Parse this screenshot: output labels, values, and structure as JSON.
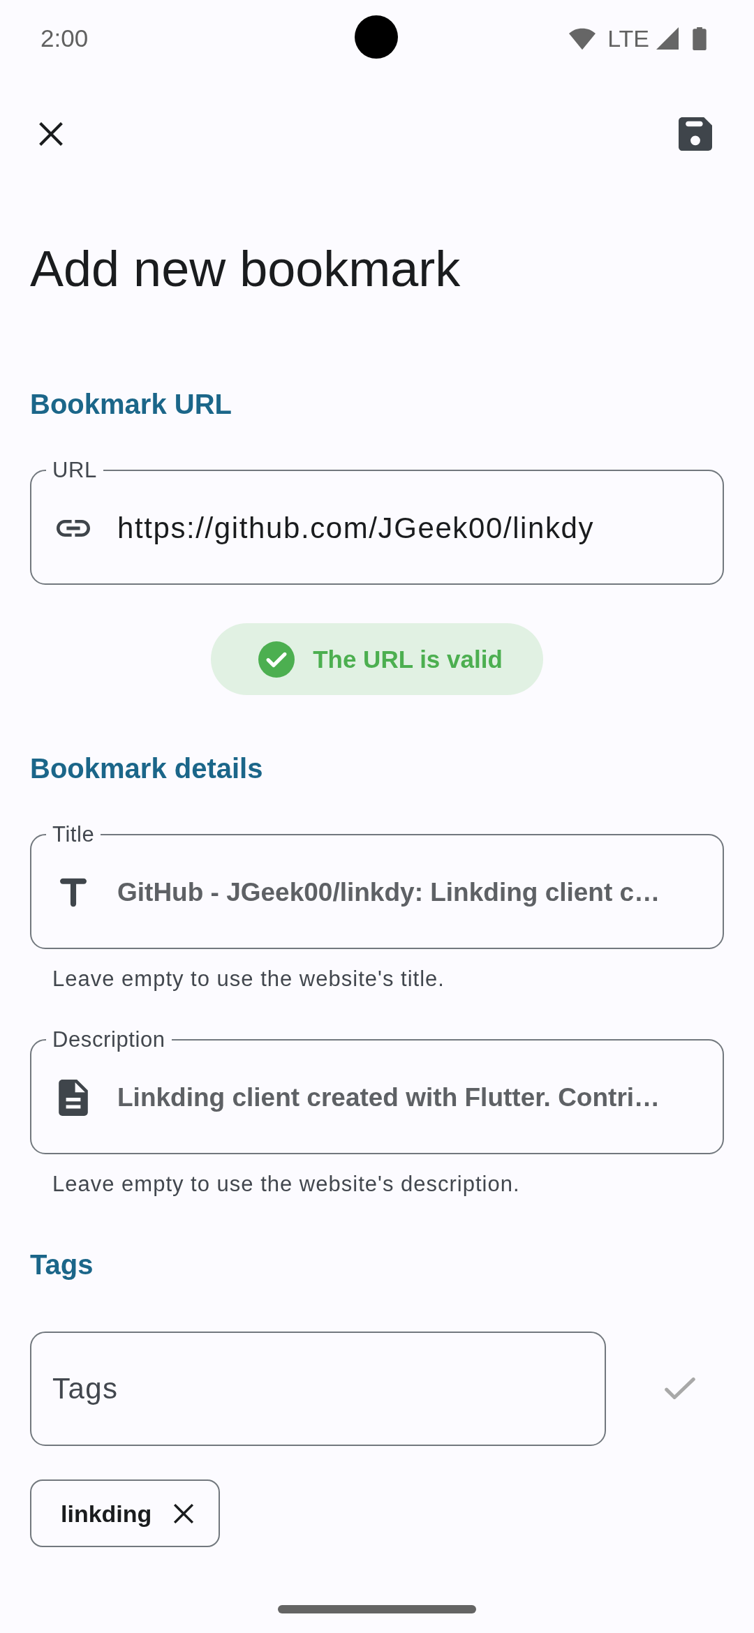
{
  "status_bar": {
    "time": "2:00",
    "network": "LTE"
  },
  "page_title": "Add new bookmark",
  "url_section": {
    "heading": "Bookmark URL",
    "field": {
      "label": "URL",
      "value": "https://github.com/JGeek00/linkdy"
    },
    "validation": {
      "kind": "success",
      "text": "The URL is valid"
    }
  },
  "details_section": {
    "heading": "Bookmark details",
    "fields": [
      {
        "kind": "title",
        "label": "Title",
        "placeholder": "GitHub - JGeek00/linkdy: Linkding client c…",
        "helper": "Leave empty to use the website's title."
      },
      {
        "kind": "description",
        "label": "Description",
        "placeholder": "Linkding client created with Flutter. Contri…",
        "helper": "Leave empty to use the website's description."
      }
    ]
  },
  "tags_section": {
    "heading": "Tags",
    "field": {
      "placeholder": "Tags"
    },
    "confirm_button": {
      "disabled": true
    },
    "chips": [
      {
        "label": "linkding"
      }
    ]
  }
}
